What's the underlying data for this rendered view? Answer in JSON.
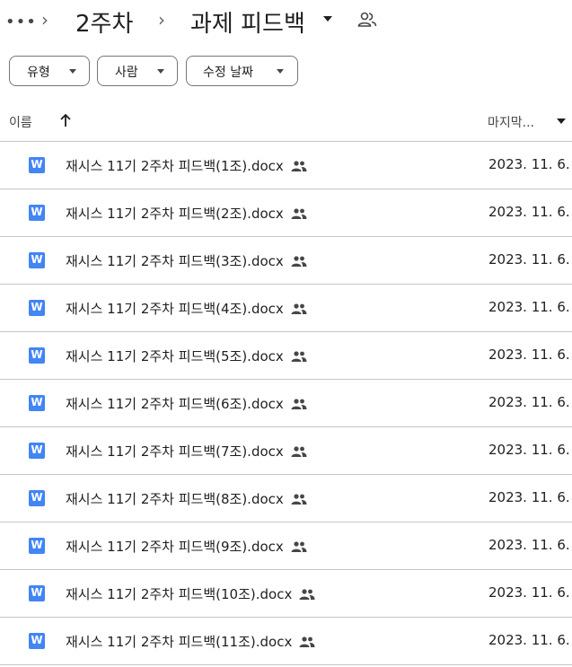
{
  "breadcrumb": {
    "more": "•••",
    "items": [
      "2주차",
      "과제 피드백"
    ]
  },
  "filters": [
    {
      "label": "유형"
    },
    {
      "label": "사람"
    },
    {
      "label": "수정 날짜"
    }
  ],
  "header": {
    "name_label": "이름",
    "sort_icon": "arrow-up-icon",
    "modified_label": "마지막..."
  },
  "files": [
    {
      "name": "재시스 11기 2주차 피드백(1조).docx",
      "date": "2023. 11. 6."
    },
    {
      "name": "재시스 11기 2주차 피드백(2조).docx",
      "date": "2023. 11. 6."
    },
    {
      "name": "재시스 11기 2주차 피드백(3조).docx",
      "date": "2023. 11. 6."
    },
    {
      "name": "재시스 11기 2주차 피드백(4조).docx",
      "date": "2023. 11. 6."
    },
    {
      "name": "재시스 11기 2주차 피드백(5조).docx",
      "date": "2023. 11. 6."
    },
    {
      "name": "재시스 11기 2주차 피드백(6조).docx",
      "date": "2023. 11. 6."
    },
    {
      "name": "재시스 11기 2주차 피드백(7조).docx",
      "date": "2023. 11. 6."
    },
    {
      "name": "재시스 11기 2주차 피드백(8조).docx",
      "date": "2023. 11. 6."
    },
    {
      "name": "재시스 11기 2주차 피드백(9조).docx",
      "date": "2023. 11. 6."
    },
    {
      "name": "재시스 11기 2주차 피드백(10조).docx",
      "date": "2023. 11. 6."
    },
    {
      "name": "재시스 11기 2주차 피드백(11조).docx",
      "date": "2023. 11. 6."
    }
  ],
  "file_icon": {
    "name": "word-doc-icon",
    "letter": "W",
    "color": "#4285f4"
  },
  "shared_icon": "people-icon"
}
